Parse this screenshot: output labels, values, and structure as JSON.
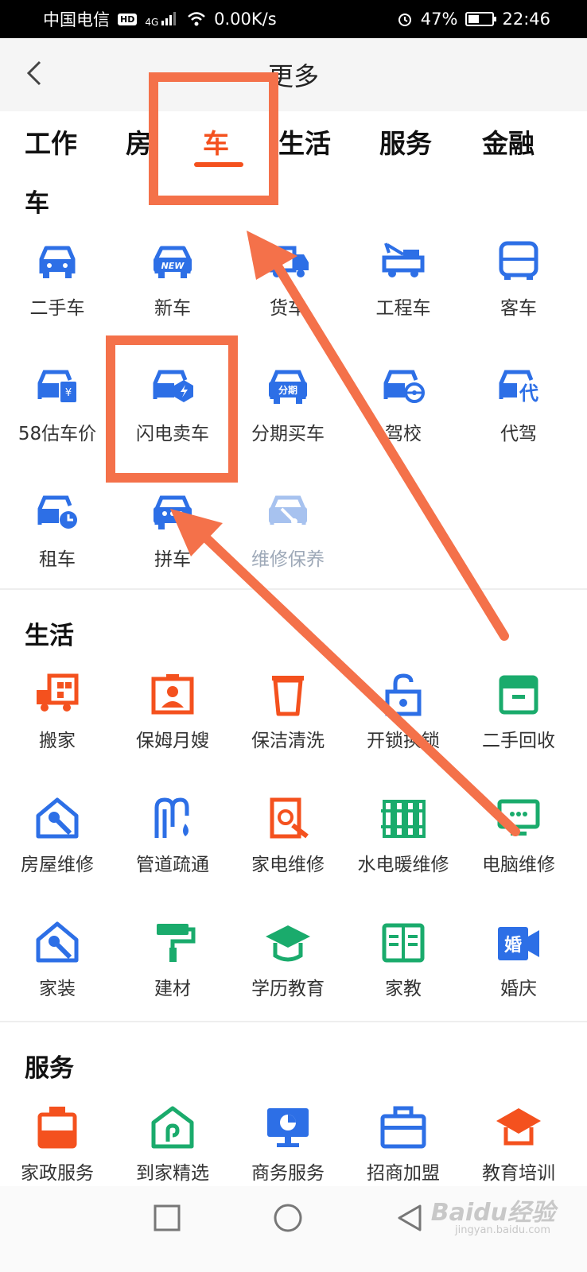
{
  "status_bar": {
    "carrier": "中国电信",
    "hd": "HD",
    "network": "4G",
    "speed": "0.00K/s",
    "battery_percent": "47%",
    "battery_level": 0.47,
    "time": "22:46"
  },
  "header": {
    "back_icon": "chevron-left-icon",
    "title": "更多"
  },
  "tabs": [
    {
      "label": "工作"
    },
    {
      "label": "房"
    },
    {
      "label": "车"
    },
    {
      "label": "生活"
    },
    {
      "label": "服务"
    },
    {
      "label": "金融"
    }
  ],
  "active_tab": "车",
  "colors": {
    "accent": "#f4511e",
    "car_icons": "#2d6fe6",
    "life_orange": "#f4511e",
    "life_green": "#1aab6c",
    "annotation": "#f4714a"
  },
  "sections": {
    "car": {
      "title": "车",
      "items": [
        {
          "label": "二手车",
          "icon": "car-icon"
        },
        {
          "label": "新车",
          "icon": "new-car-icon"
        },
        {
          "label": "货车",
          "icon": "truck-icon"
        },
        {
          "label": "工程车",
          "icon": "tow-truck-icon"
        },
        {
          "label": "客车",
          "icon": "bus-icon"
        },
        {
          "label": "58估车价",
          "icon": "car-price-icon"
        },
        {
          "label": "闪电卖车",
          "icon": "lightning-sell-icon"
        },
        {
          "label": "分期买车",
          "icon": "installment-car-icon"
        },
        {
          "label": "驾校",
          "icon": "driving-school-icon"
        },
        {
          "label": "代驾",
          "icon": "designated-driver-icon"
        },
        {
          "label": "租车",
          "icon": "car-rental-icon"
        },
        {
          "label": "拼车",
          "icon": "carpool-icon"
        },
        {
          "label": "维修保养",
          "icon": "car-repair-icon"
        }
      ]
    },
    "life": {
      "title": "生活",
      "items": [
        {
          "label": "搬家",
          "icon": "moving-icon"
        },
        {
          "label": "保姆月嫂",
          "icon": "nanny-icon"
        },
        {
          "label": "保洁清洗",
          "icon": "cleaning-icon"
        },
        {
          "label": "开锁换锁",
          "icon": "lock-icon"
        },
        {
          "label": "二手回收",
          "icon": "recycle-box-icon"
        },
        {
          "label": "房屋维修",
          "icon": "house-repair-icon"
        },
        {
          "label": "管道疏通",
          "icon": "pipe-icon"
        },
        {
          "label": "家电维修",
          "icon": "appliance-repair-icon"
        },
        {
          "label": "水电暖维修",
          "icon": "radiator-icon"
        },
        {
          "label": "电脑维修",
          "icon": "computer-icon"
        },
        {
          "label": "家装",
          "icon": "home-decor-icon"
        },
        {
          "label": "建材",
          "icon": "paint-roller-icon"
        },
        {
          "label": "学历教育",
          "icon": "graduation-cap-icon"
        },
        {
          "label": "家教",
          "icon": "book-icon"
        },
        {
          "label": "婚庆",
          "icon": "wedding-icon"
        }
      ]
    },
    "service": {
      "title": "服务",
      "items": [
        {
          "label": "家政服务",
          "icon": "housekeeping-icon"
        },
        {
          "label": "到家精选",
          "icon": "home-select-icon"
        },
        {
          "label": "商务服务",
          "icon": "business-screen-icon"
        },
        {
          "label": "招商加盟",
          "icon": "briefcase-icon"
        },
        {
          "label": "教育培训",
          "icon": "training-icon"
        }
      ]
    }
  },
  "system_nav": {
    "recent": "square-icon",
    "home": "circle-icon",
    "back": "triangle-back-icon"
  },
  "watermark": {
    "text": "Baidu经验",
    "sub": "jingyan.baidu.com"
  }
}
